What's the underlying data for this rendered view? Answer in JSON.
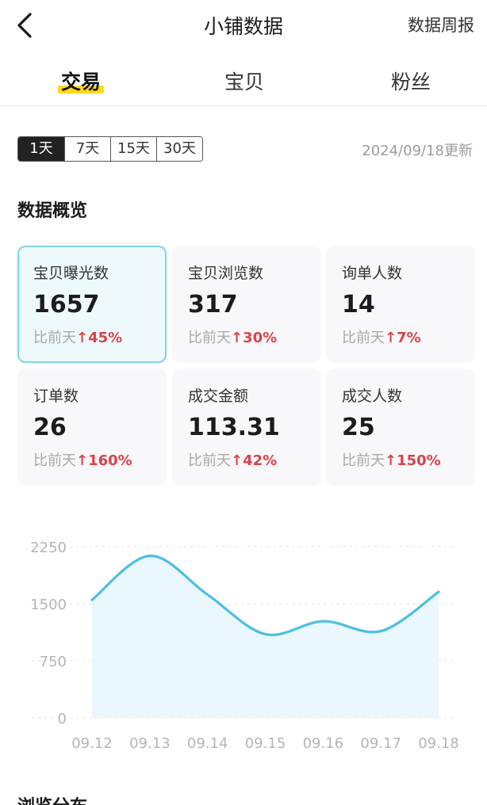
{
  "header": {
    "title": "小铺数据",
    "weekly_report": "数据周报"
  },
  "tabs": [
    {
      "label": "交易",
      "active": true
    },
    {
      "label": "宝贝",
      "active": false
    },
    {
      "label": "粉丝",
      "active": false
    }
  ],
  "ranges": [
    {
      "label": "1天",
      "active": true
    },
    {
      "label": "7天",
      "active": false
    },
    {
      "label": "15天",
      "active": false
    },
    {
      "label": "30天",
      "active": false
    }
  ],
  "updated_text": "2024/09/18更新",
  "overview": {
    "title": "数据概览",
    "compare_label": "比前天",
    "cards": [
      {
        "label": "宝贝曝光数",
        "value": "1657",
        "change": "45%",
        "selected": true
      },
      {
        "label": "宝贝浏览数",
        "value": "317",
        "change": "30%",
        "selected": false
      },
      {
        "label": "询单人数",
        "value": "14",
        "change": "7%",
        "selected": false
      },
      {
        "label": "订单数",
        "value": "26",
        "change": "160%",
        "selected": false
      },
      {
        "label": "成交金额",
        "value": "113.31",
        "change": "42%",
        "selected": false
      },
      {
        "label": "成交人数",
        "value": "25",
        "change": "150%",
        "selected": false
      }
    ]
  },
  "chart_data": {
    "type": "area",
    "x": [
      "09.12",
      "09.13",
      "09.14",
      "09.15",
      "09.16",
      "09.17",
      "09.18"
    ],
    "values": [
      1550,
      2130,
      1620,
      1100,
      1270,
      1140,
      1657
    ],
    "yticks": [
      "0",
      "750",
      "1500",
      "2250"
    ],
    "ylim": [
      0,
      2250
    ],
    "grid": true,
    "line_color": "#4cbfe3",
    "fill_color": "#eaf7fd"
  },
  "next_section": {
    "title": "浏览分布"
  },
  "colors": {
    "accent_yellow": "#ffd91a",
    "selected_border": "#7fd6e6",
    "up_red": "#d9434b"
  }
}
